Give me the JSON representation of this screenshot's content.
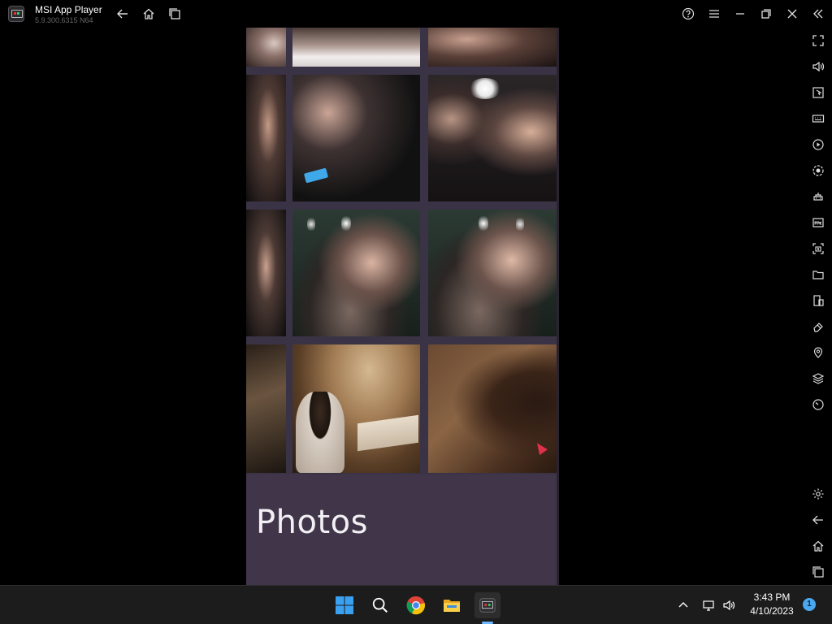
{
  "window": {
    "title": "MSI App Player",
    "version": "5.9.300.6315  N64"
  },
  "app": {
    "section_label": "Photos"
  },
  "taskbar": {
    "time": "3:43 PM",
    "date": "4/10/2023",
    "notification_count": "1"
  },
  "colors": {
    "gallery_background": "#3a3346",
    "photos_panel": "#413649",
    "taskbar": "#1c1c1c",
    "accent": "#4aa8f0"
  },
  "photos": [
    {
      "id": "r0c0",
      "scene": "warm-portrait-crop"
    },
    {
      "id": "r0c1",
      "scene": "two-friends-top"
    },
    {
      "id": "r0c2",
      "scene": "two-friends-selfie"
    },
    {
      "id": "r1c0",
      "scene": "woman-side"
    },
    {
      "id": "r1c1",
      "scene": "friends-with-phone"
    },
    {
      "id": "r1c2",
      "scene": "bar-with-wine-glasses"
    },
    {
      "id": "r2c0",
      "scene": "woman-with-glass-crop"
    },
    {
      "id": "r2c1",
      "scene": "woman-drinking-wine"
    },
    {
      "id": "r2c2",
      "scene": "woman-smiling-wine"
    },
    {
      "id": "r3c0",
      "scene": "dim-room-crop"
    },
    {
      "id": "r3c1",
      "scene": "woman-writing-desk"
    },
    {
      "id": "r3c2",
      "scene": "dark-warm-room"
    }
  ]
}
